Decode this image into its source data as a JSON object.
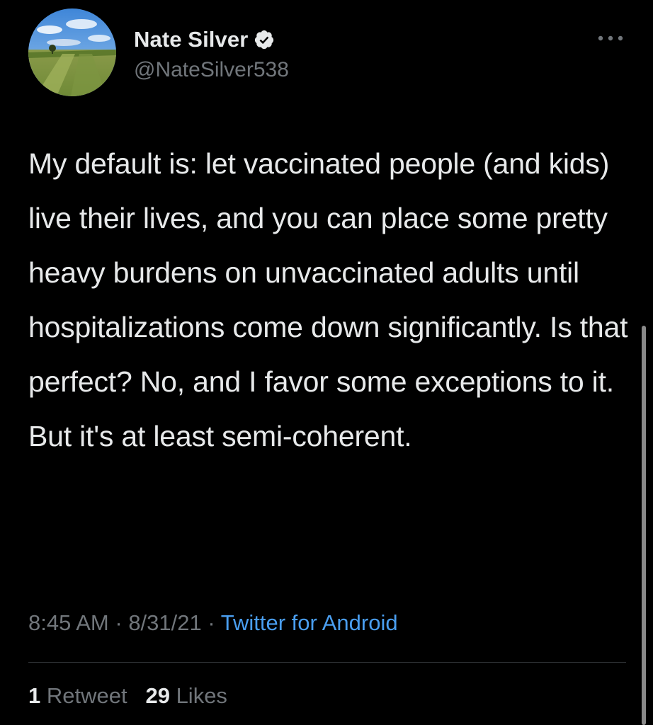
{
  "author": {
    "display_name": "Nate Silver",
    "handle": "@NateSilver538",
    "verified": true,
    "avatar_icon": "field-landscape-avatar"
  },
  "tweet": {
    "text": "My default is: let vaccinated people (and kids) live their lives, and you can place some pretty heavy burdens on unvaccinated adults until hospitalizations come down significantly. Is that perfect? No, and I favor some exceptions to it. But it's at least semi-coherent."
  },
  "meta": {
    "time": "8:45 AM",
    "separator": " · ",
    "date": "8/31/21",
    "source": "Twitter for Android"
  },
  "stats": {
    "retweets_count": "1",
    "retweets_label": "Retweet",
    "likes_count": "29",
    "likes_label": "Likes"
  },
  "icons": {
    "more": "more-options-icon",
    "verified": "verified-badge-icon"
  },
  "colors": {
    "background": "#000000",
    "text_primary": "#e7e9ea",
    "text_secondary": "#71767b",
    "link": "#4a9ef0",
    "divider": "#2f3336"
  }
}
